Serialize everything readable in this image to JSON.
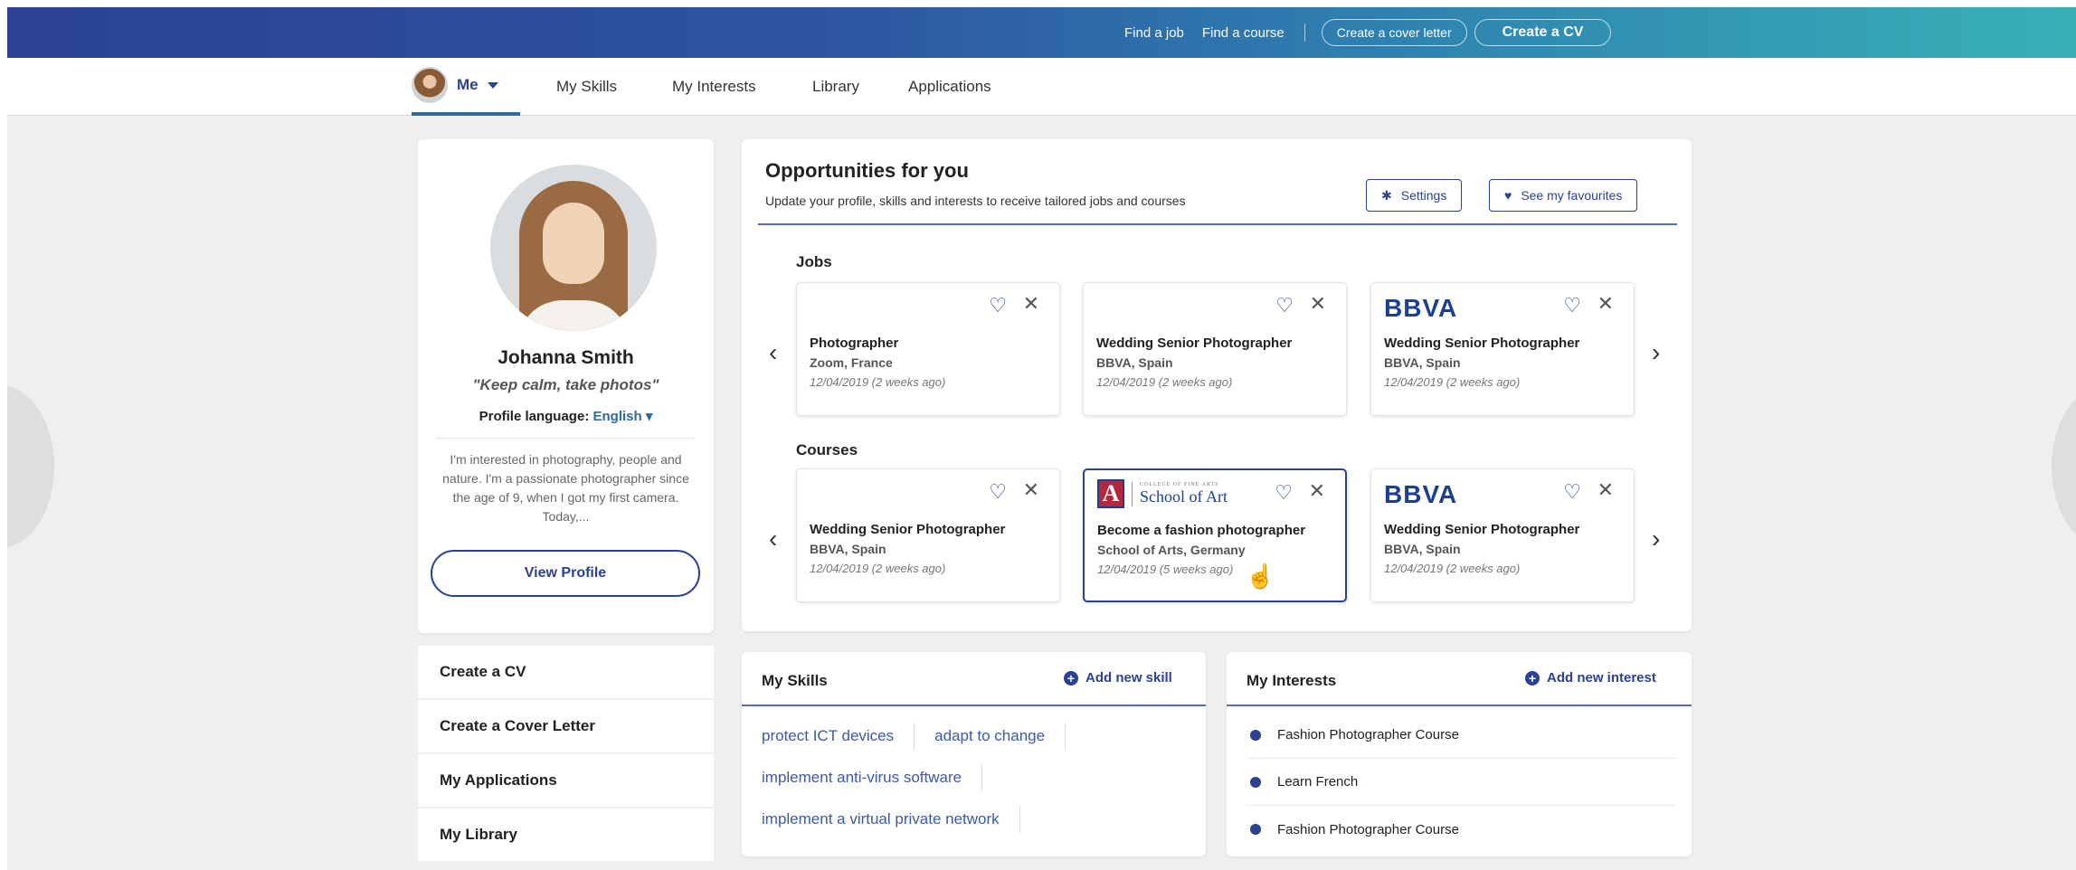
{
  "topbar": {
    "links": [
      "Find a job",
      "Find a course"
    ],
    "cover_letter_btn": "Create a cover letter",
    "cv_btn": "Create a CV"
  },
  "nav": {
    "me_label": "Me",
    "items": [
      "My Skills",
      "My Interests",
      "Library",
      "Applications"
    ]
  },
  "profile": {
    "name": "Johanna Smith",
    "quote": "\"Keep calm, take photos\"",
    "language_label": "Profile language:",
    "language_value": "English",
    "bio": "I'm interested in photography, people and nature. I'm a passionate photographer since the age of 9, when I got my first camera. Today,...",
    "view_profile": "View Profile"
  },
  "side_menu": [
    "Create a CV",
    "Create a Cover Letter",
    "My Applications",
    "My Library"
  ],
  "opportunities": {
    "title": "Opportunities for you",
    "subtitle": "Update your profile, skills and interests to receive tailored jobs and courses",
    "settings_btn": "Settings",
    "favourites_btn": "See my favourites",
    "jobs_label": "Jobs",
    "courses_label": "Courses",
    "jobs": [
      {
        "title": "Photographer",
        "location": "Zoom, France",
        "date": "12/04/2019 (2 weeks ago)",
        "logo": ""
      },
      {
        "title": "Wedding Senior Photographer",
        "location": "BBVA, Spain",
        "date": "12/04/2019 (2 weeks ago)",
        "logo": ""
      },
      {
        "title": "Wedding Senior Photographer",
        "location": "BBVA, Spain",
        "date": "12/04/2019 (2 weeks ago)",
        "logo": "BBVA"
      }
    ],
    "courses": [
      {
        "title": "Wedding Senior Photographer",
        "location": "BBVA, Spain",
        "date": "12/04/2019 (2 weeks ago)",
        "logo": ""
      },
      {
        "title": "Become a fashion photographer",
        "location": "School of Arts, Germany",
        "date": "12/04/2019 (5 weeks ago)",
        "logo": "School of Art",
        "logo_small": "COLLEGE OF FINE ARTS"
      },
      {
        "title": "Wedding Senior Photographer",
        "location": "BBVA, Spain",
        "date": "12/04/2019 (2 weeks ago)",
        "logo": "BBVA"
      }
    ]
  },
  "skills": {
    "title": "My Skills",
    "add": "Add new skill",
    "items": [
      "protect ICT devices",
      "adapt to change",
      "implement anti-virus software",
      "implement a virtual private network"
    ]
  },
  "interests": {
    "title": "My Interests",
    "add": "Add new interest",
    "items": [
      "Fashion Photographer Course",
      "Learn French",
      "Fashion Photographer Course"
    ]
  },
  "colors": {
    "brand": "#2b4194",
    "topbar_start": "#2b4194",
    "topbar_end": "#37b1b6",
    "background": "#efefef"
  }
}
